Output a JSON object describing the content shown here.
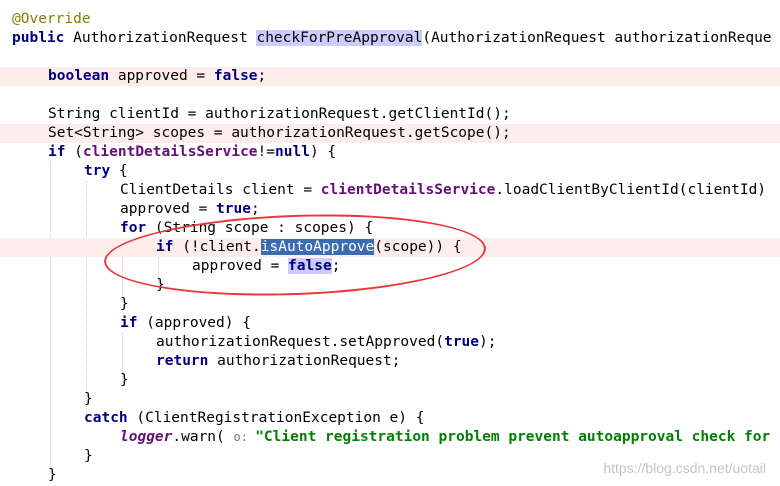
{
  "code": {
    "annotation": "@Override",
    "kw_public": "public",
    "kw_boolean": "boolean",
    "kw_false": "false",
    "kw_true": "true",
    "kw_if": "if",
    "kw_null": "null",
    "kw_try": "try",
    "kw_for": "for",
    "kw_return": "return",
    "kw_catch": "catch",
    "return_type": "AuthorizationRequest",
    "method_name": "checkForPreApproval",
    "method_params": "(AuthorizationRequest authorizationReque",
    "approved_decl": "approved = ",
    "client_id_line": "String clientId = authorizationRequest.getClientId();",
    "scopes_line": "Set<String> scopes = authorizationRequest.getScope();",
    "client_service_field": "clientDetailsService",
    "if_open": " (",
    "not_equal": "!=",
    "close_brace_open": ") {",
    "brace_open": " {",
    "client_details_decl": "ClientDetails client = ",
    "load_client_call": ".loadClientByClientId(clientId)",
    "approved_assign": "approved = ",
    "for_header": " (String scope : scopes) {",
    "if_not_client": " (!client.",
    "is_auto_approve": "isAutoApprove",
    "scope_arg": "(scope)) {",
    "close_brace": "}",
    "approved_check": " (approved) {",
    "set_approved_call": "authorizationRequest.setApproved(",
    "call_close": ");",
    "return_value": " authorizationRequest;",
    "catch_header": " (ClientRegistrationException e) {",
    "logger_field": "logger",
    "warn_call": ".warn( ",
    "param_hint": "o: ",
    "warn_message": "\"Client registration problem prevent autoapproval check for",
    "semicolon": ";"
  },
  "watermark": "https://blog.csdn.net/uotail"
}
